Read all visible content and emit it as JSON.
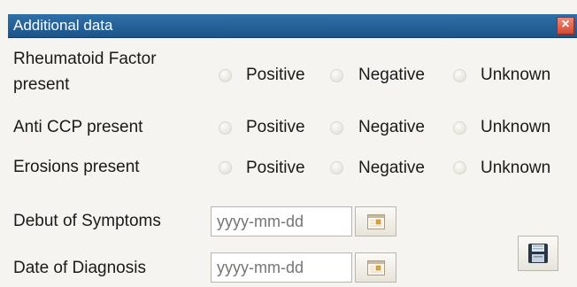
{
  "window": {
    "title": "Additional data",
    "close_label": "×"
  },
  "rows": [
    {
      "label_line1": "Rheumatoid Factor",
      "label_line2": "present",
      "options": [
        "Positive",
        "Negative",
        "Unknown"
      ]
    },
    {
      "label_line1": "Anti CCP present",
      "options": [
        "Positive",
        "Negative",
        "Unknown"
      ]
    },
    {
      "label_line1": "Erosions present",
      "options": [
        "Positive",
        "Negative",
        "Unknown"
      ]
    }
  ],
  "dates": [
    {
      "label": "Debut of Symptoms",
      "placeholder": "yyyy-mm-dd"
    },
    {
      "label": "Date of Diagnosis",
      "placeholder": "yyyy-mm-dd"
    }
  ],
  "icons": {
    "close": "close-icon",
    "calendar": "calendar-icon",
    "save": "floppy-disk-icon"
  },
  "colors": {
    "titlebar": "#1c5489",
    "close": "#d44a33",
    "background": "#f5f4f0"
  }
}
